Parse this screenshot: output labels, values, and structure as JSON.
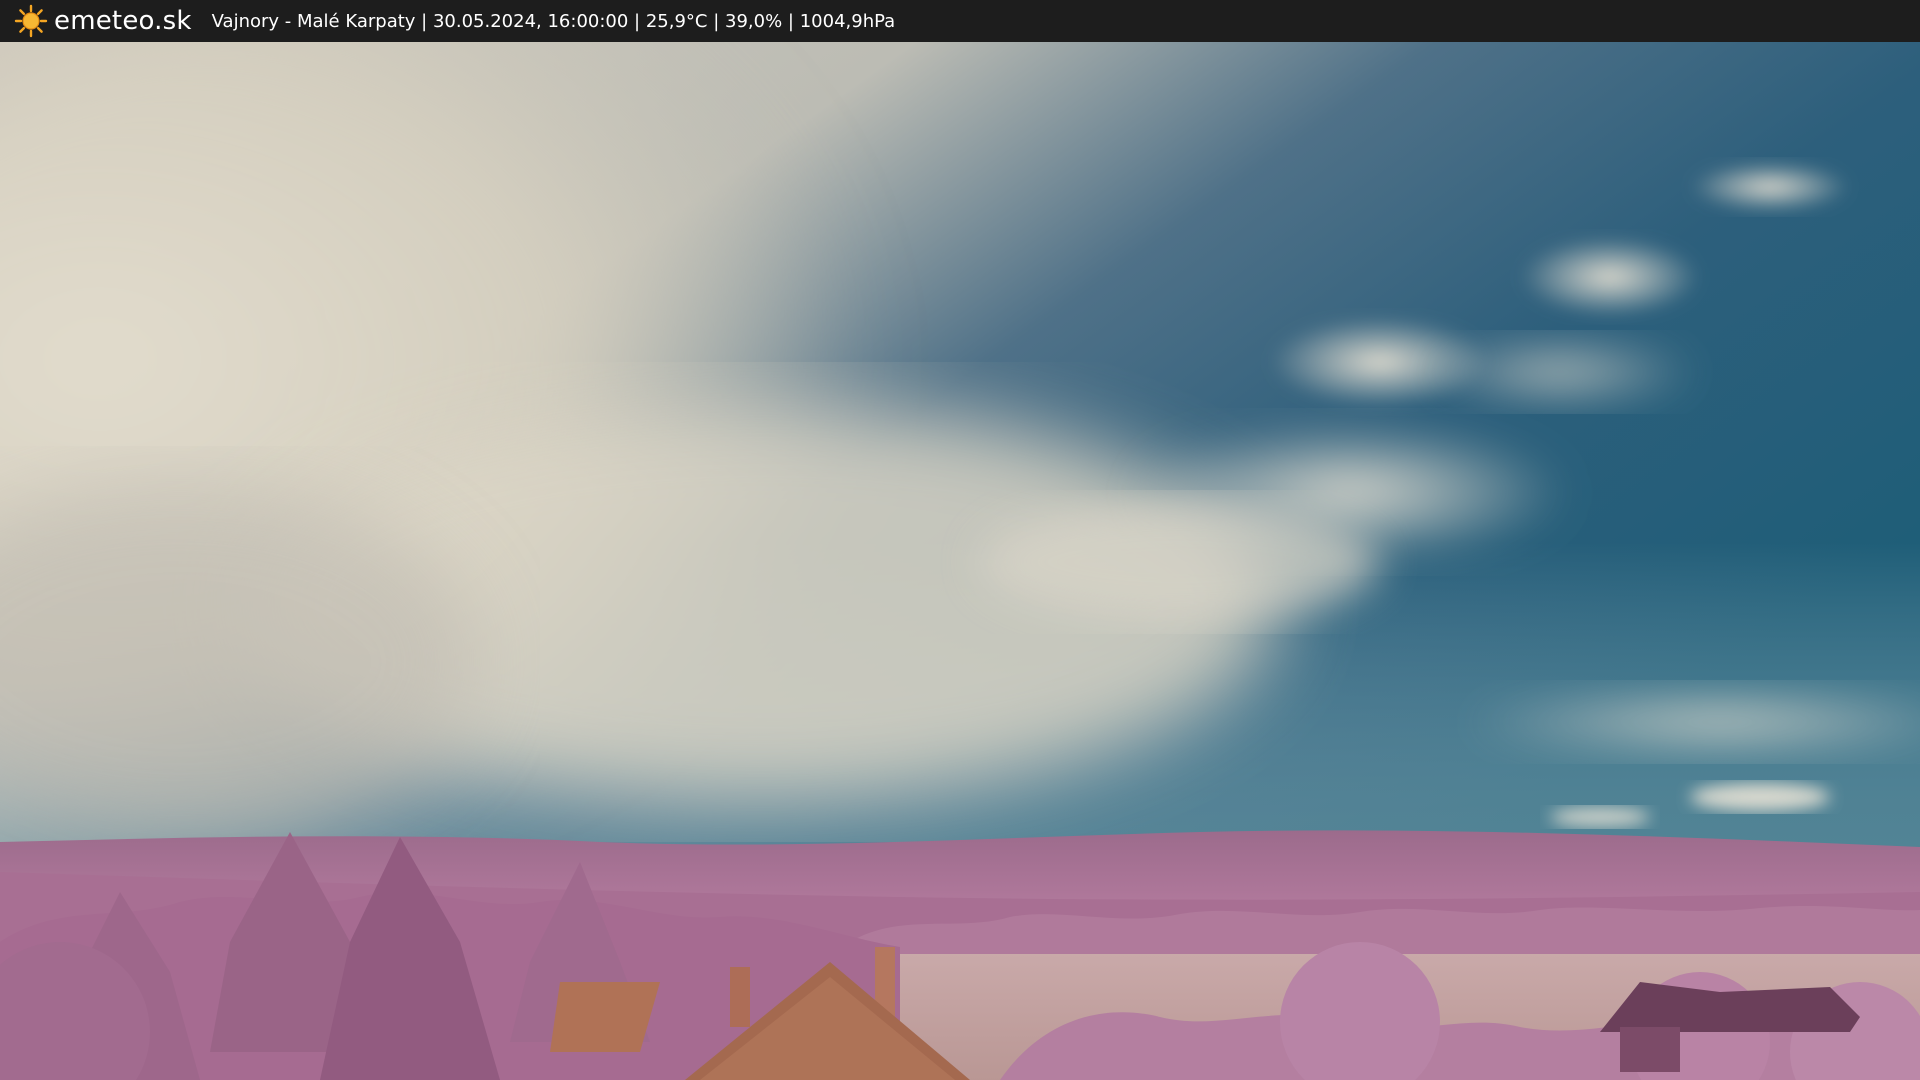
{
  "brand": {
    "name": "emeteo.sk",
    "icon": "sun-icon"
  },
  "caption": {
    "location": "Vajnory - Malé Karpaty",
    "datetime": "30.05.2024, 16:00:00",
    "temperature": "25,9°C",
    "humidity": "39,0%",
    "pressure": "1004,9hPa",
    "separator": " | "
  },
  "colors": {
    "bar": "#1d1d1d",
    "sky_blue": "#1f6a86",
    "cloud": "#d9d3c3",
    "foliage": "#a86a92",
    "field": "#c3a6a4",
    "roof": "#a4694f",
    "sun": "#f5a623"
  }
}
